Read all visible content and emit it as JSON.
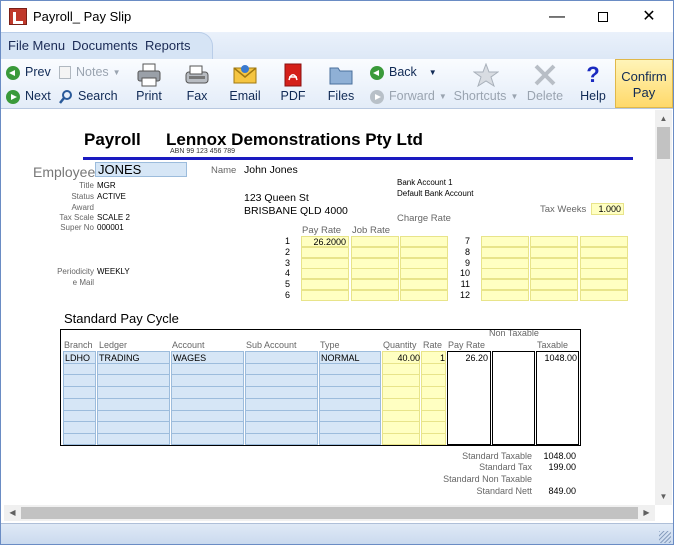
{
  "window": {
    "title": "Payroll_ Pay Slip",
    "minimize_label": "—",
    "close_label": "✕"
  },
  "menu": {
    "items": [
      "File Menu",
      "Documents",
      "Reports"
    ]
  },
  "toolbar": {
    "prev": "Prev",
    "next": "Next",
    "notes": "Notes",
    "search": "Search",
    "print": "Print",
    "fax": "Fax",
    "email": "Email",
    "pdf": "PDF",
    "files": "Files",
    "back": "Back",
    "forward": "Forward",
    "shortcuts": "Shortcuts",
    "delete": "Delete",
    "help": "Help",
    "confirm_line1": "Confirm",
    "confirm_line2": "Pay"
  },
  "document": {
    "heading": "Payroll",
    "company": "Lennox Demonstrations Pty Ltd",
    "abn": "ABN  99 123 456 789",
    "employee_label": "Employee",
    "employee_code": "JONES",
    "name_label": "Name",
    "name_value": "John Jones",
    "address_line1": "123 Queen St",
    "address_line2": "BRISBANE QLD 4000",
    "bank_account": "Bank Account 1",
    "default_bank": "Default Bank Account",
    "charge_rate_label": "Charge Rate",
    "tax_weeks_label": "Tax Weeks",
    "tax_weeks_value": "1.000",
    "fields": [
      {
        "label": "Title",
        "value": "MGR"
      },
      {
        "label": "Status",
        "value": "ACTIVE"
      },
      {
        "label": "Award",
        "value": ""
      },
      {
        "label": "Tax Scale",
        "value": "SCALE 2"
      },
      {
        "label": "Super No",
        "value": "000001"
      }
    ],
    "periodicity_label": "Periodicity",
    "periodicity_value": "WEEKLY",
    "email_label": "e Mail",
    "pay_rate_header": "Pay Rate",
    "job_rate_header": "Job Rate",
    "rate_rows_left": [
      "1",
      "2",
      "3",
      "4",
      "5",
      "6"
    ],
    "rate_rows_right": [
      "7",
      "8",
      "9",
      "10",
      "11",
      "12"
    ],
    "first_pay_rate": "26.2000"
  },
  "pay_cycle": {
    "title": "Standard Pay Cycle",
    "non_taxable_header": "Non Taxable",
    "columns": [
      "Branch",
      "Ledger",
      "Account",
      "Sub Account",
      "Type",
      "Quantity",
      "Rate",
      "Pay Rate",
      "Taxable"
    ],
    "row": {
      "branch": "LDHO",
      "ledger": "TRADING",
      "account": "WAGES",
      "sub_account": "",
      "type": "NORMAL",
      "quantity": "40.00",
      "rate": "1",
      "pay_rate": "26.20",
      "non_taxable": "",
      "taxable": "1048.00"
    }
  },
  "totals": [
    {
      "label": "Standard Taxable",
      "value": "1048.00"
    },
    {
      "label": "Standard Tax",
      "value": "199.00"
    },
    {
      "label": "Standard Non Taxable",
      "value": ""
    },
    {
      "label": "Standard Nett",
      "value": "849.00"
    }
  ]
}
